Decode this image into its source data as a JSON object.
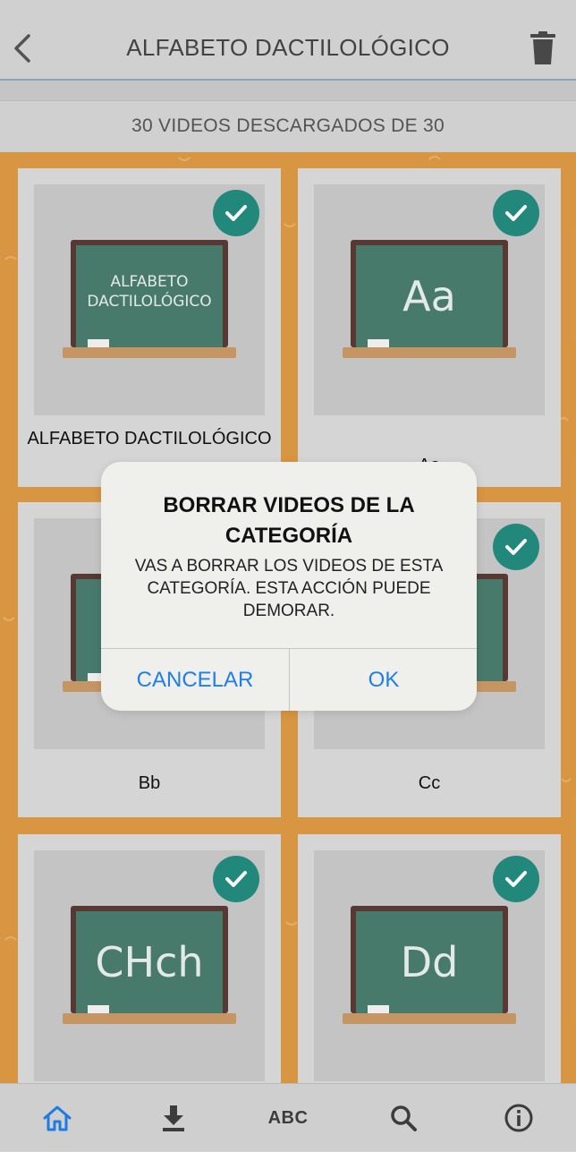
{
  "header": {
    "title": "ALFABETO DACTILOLÓGICO",
    "back_icon": "chevron-left-icon",
    "trash_icon": "trash-icon"
  },
  "download_status": "30 VIDEOS DESCARGADOS DE 30",
  "cards": [
    {
      "board_text": "ALFABETO DACTILOLÓGICO",
      "label": "ALFABETO DACTILOLÓGICO",
      "downloaded": true
    },
    {
      "board_text": "Aa",
      "label": "Aa",
      "downloaded": true
    },
    {
      "board_text": "",
      "label": "Bb",
      "downloaded": true
    },
    {
      "board_text": "",
      "label": "Cc",
      "downloaded": true
    },
    {
      "board_text": "CHch",
      "label": "",
      "downloaded": true
    },
    {
      "board_text": "Dd",
      "label": "",
      "downloaded": true
    }
  ],
  "dialog": {
    "title": "BORRAR VIDEOS DE LA CATEGORÍA",
    "message": "VAS A BORRAR LOS VIDEOS DE ESTA CATEGORÍA. ESTA ACCIÓN PUEDE DEMORAR.",
    "cancel_label": "CANCELAR",
    "ok_label": "OK"
  },
  "bottom_nav": {
    "items": [
      {
        "icon": "home-icon",
        "active": true
      },
      {
        "icon": "download-icon"
      },
      {
        "label": "ABC"
      },
      {
        "icon": "search-icon"
      },
      {
        "icon": "info-icon"
      }
    ]
  },
  "colors": {
    "accent_blue": "#1f7ee8",
    "grid_background": "#dd9a45",
    "check_badge": "#248b7f",
    "board_green": "#4a7d6f"
  }
}
